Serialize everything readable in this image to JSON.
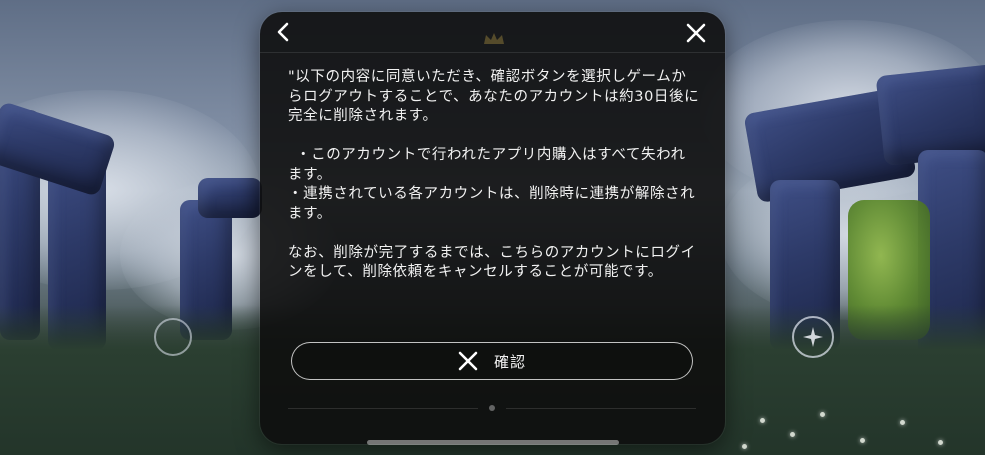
{
  "dialog": {
    "paragraph_1": "\"以下の内容に同意いただき、確認ボタンを選択しゲームからログアウトすることで、あなたのアカウントは約30日後に完全に削除されます。",
    "bullet_1": "・このアカウントで行われたアプリ内購入はすべて失われます。",
    "bullet_2": "・連携されている各アカウントは、削除時に連携が解除されます。",
    "paragraph_2": "なお、削除が完了するまでは、こちらのアカウントにログインをして、削除依頼をキャンセルすることが可能です。",
    "confirm_label": "確認"
  },
  "icons": {
    "back": "chevron-left-icon",
    "close": "close-icon",
    "confirm": "x-icon",
    "side_left": "ring-icon",
    "side_right": "star-icon"
  },
  "colors": {
    "dialog_bg": "#0e0e0e",
    "text": "#f2f2f2",
    "button_border": "#ffffff"
  }
}
